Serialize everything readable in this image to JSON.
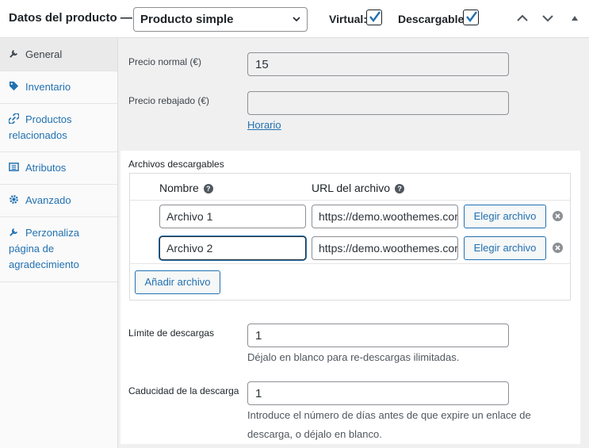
{
  "header": {
    "title": "Datos del producto —",
    "product_type": "Producto simple",
    "virtual_label": "Virtual:",
    "downloadable_label": "Descargable:",
    "virtual_checked": true,
    "downloadable_checked": true
  },
  "sidebar": {
    "items": [
      {
        "label": "General",
        "icon": "wrench-icon"
      },
      {
        "label": "Inventario",
        "icon": "tag-icon"
      },
      {
        "label": "Productos relacionados",
        "icon": "link-icon"
      },
      {
        "label": "Atributos",
        "icon": "list-icon"
      },
      {
        "label": "Avanzado",
        "icon": "gear-icon"
      },
      {
        "label": "Perzonaliza página de agradecimiento",
        "icon": "wrench-icon"
      }
    ]
  },
  "general": {
    "regular_price_label": "Precio normal (€)",
    "regular_price_value": "15",
    "sale_price_label": "Precio rebajado (€)",
    "sale_price_value": "",
    "schedule_link": "Horario"
  },
  "downloads": {
    "section_label": "Archivos descargables",
    "col_name": "Nombre",
    "col_url": "URL del archivo",
    "files": [
      {
        "name": "Archivo 1",
        "url": "https://demo.woothemes.com"
      },
      {
        "name": "Archivo 2",
        "url": "https://demo.woothemes.com"
      }
    ],
    "choose_label": "Elegir archivo",
    "add_label": "Añadir archivo",
    "limit_label": "Límite de descargas",
    "limit_value": "1",
    "limit_desc": "Déjalo en blanco para re-descargas ilimitadas.",
    "expiry_label": "Caducidad de la descarga",
    "expiry_value": "1",
    "expiry_desc_1": "Introduce el número de días antes de que expire un enlace de",
    "expiry_desc_2": "descarga, o déjalo en blanco."
  },
  "colors": {
    "accent": "#2271b1",
    "text": "#1d2327"
  }
}
